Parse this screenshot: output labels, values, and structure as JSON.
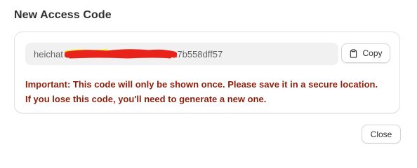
{
  "dialog": {
    "title": "New Access Code",
    "code_prefix": "heichat",
    "code_suffix": "da7b558dff57",
    "copy_label": "Copy",
    "copy_icon": "clipboard-icon",
    "warning_line1": "Important: This code will only be shown once. Please save it in a secure location.",
    "warning_line2": "If you lose this code, you'll need to generate a new one.",
    "close_label": "Close",
    "colors": {
      "warning_text": "#8e1f0b",
      "redaction_red": "#e8231a",
      "redaction_yellow": "#f2e21a"
    }
  }
}
